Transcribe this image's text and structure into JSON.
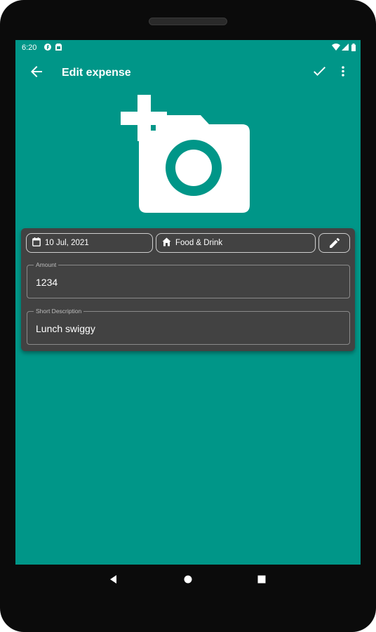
{
  "status_bar": {
    "time": "6:20",
    "left_icons": [
      "notification-f-icon",
      "sim-icon"
    ],
    "right_icons": [
      "wifi-icon",
      "signal-icon",
      "battery-icon"
    ]
  },
  "app_bar": {
    "title": "Edit expense",
    "back_icon": "arrow-back-icon",
    "save_icon": "check-icon",
    "menu_icon": "more-vert-icon"
  },
  "photo": {
    "icon": "add-a-photo-icon"
  },
  "form": {
    "date_chip": {
      "label": "10 Jul, 2021",
      "icon": "calendar-icon"
    },
    "category_chip": {
      "label": "Food & Drink",
      "icon": "home-icon"
    },
    "edit_chip": {
      "icon": "pencil-icon"
    },
    "amount": {
      "label": "Amount",
      "value": "1234"
    },
    "description": {
      "label": "Short Description",
      "value": "Lunch swiggy"
    }
  },
  "nav_bar": {
    "buttons": [
      "back-triangle-icon",
      "home-circle-icon",
      "recents-square-icon"
    ]
  },
  "colors": {
    "primary": "#009688",
    "card": "#424242",
    "on_primary": "#ffffff",
    "device_bezel": "#0b0b0b"
  }
}
